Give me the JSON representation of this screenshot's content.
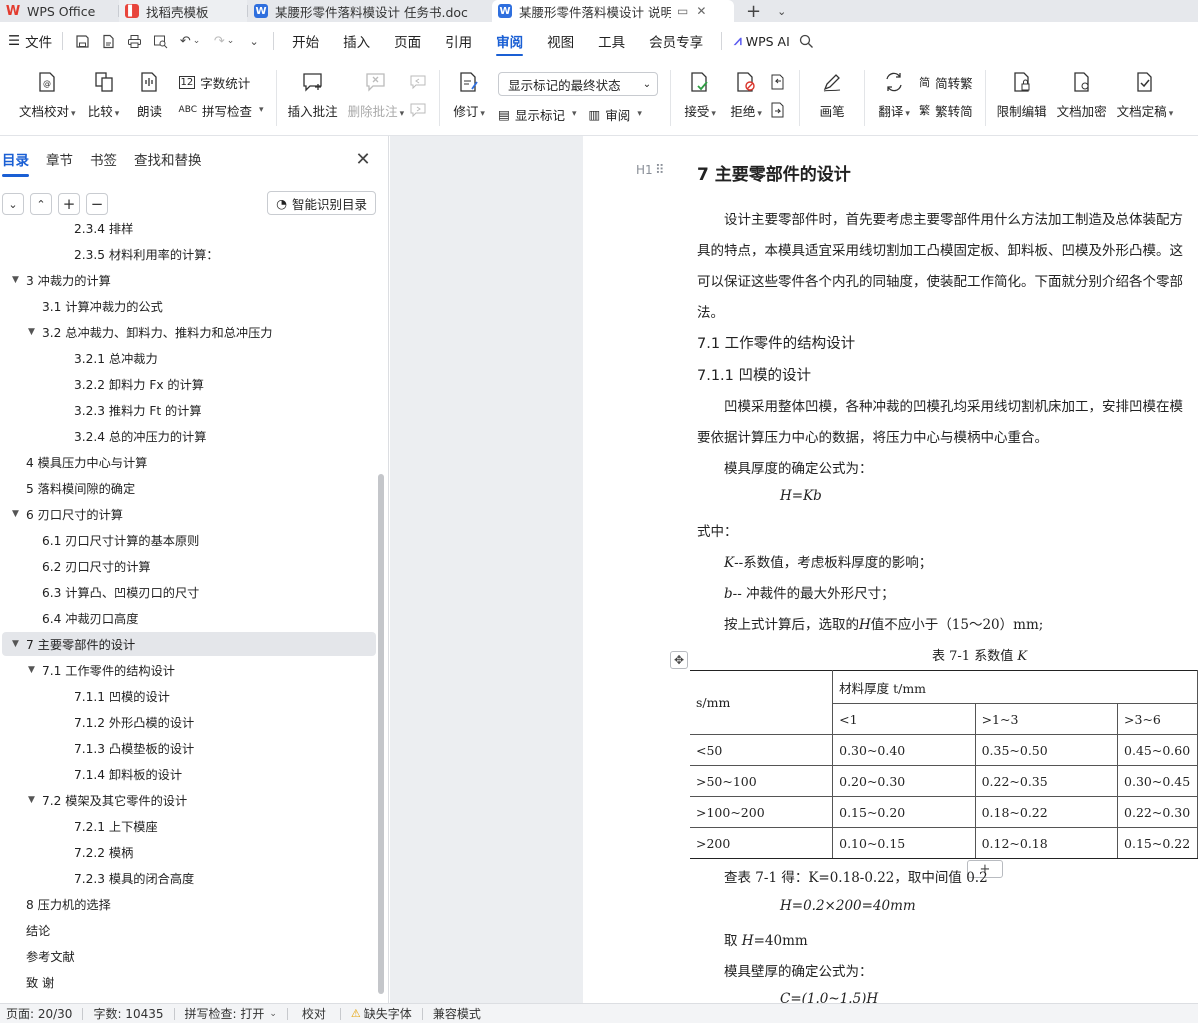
{
  "tabs": [
    {
      "label": "WPS Office",
      "icon": "wps-logo-icon",
      "color": "#e33b2e"
    },
    {
      "label": "找稻壳模板",
      "icon": "docer-icon",
      "color": "#e8453c"
    },
    {
      "label": "某腰形零件落料模设计 任务书.doc",
      "icon": "word-doc-icon",
      "color": "#2f6fde"
    },
    {
      "label": "某腰形零件落料模设计 说明书",
      "icon": "word-doc-icon",
      "color": "#2f6fde"
    }
  ],
  "menubar": {
    "file": "文件",
    "items": [
      "开始",
      "插入",
      "页面",
      "引用",
      "审阅",
      "视图",
      "工具",
      "会员专享"
    ],
    "active": "审阅",
    "ai": "WPS AI"
  },
  "ribbon": {
    "doc_check": "文档校对",
    "compare": "比较",
    "read_aloud": "朗读",
    "word_count": "字数统计",
    "spell_check": "拼写检查",
    "insert_comment": "插入批注",
    "delete_comment": "删除批注",
    "track_changes": "修订",
    "display_select": "显示标记的最终状态",
    "show_markup": "显示标记",
    "review": "审阅",
    "accept": "接受",
    "reject": "拒绝",
    "pen": "画笔",
    "translate": "翻译",
    "to_traditional": "简转繁",
    "to_simplified": "繁转简",
    "restrict_edit": "限制编辑",
    "encrypt": "文档加密",
    "finalize": "文档定稿"
  },
  "nav_panel": {
    "tabs": [
      "目录",
      "章节",
      "书签",
      "查找和替换"
    ],
    "active_tab": "目录",
    "smart_toc": "智能识别目录",
    "toc": [
      {
        "label": "2.3.4  排样",
        "level": 3,
        "arrow": ""
      },
      {
        "label": "2.3.5  材料利用率的计算：",
        "level": 3,
        "arrow": ""
      },
      {
        "label": "3  冲裁力的计算",
        "level": 1,
        "arrow": "▼"
      },
      {
        "label": "3.1  计算冲裁力的公式",
        "level": 2,
        "arrow": ""
      },
      {
        "label": "3.2  总冲裁力、卸料力、推料力和总冲压力",
        "level": 2,
        "arrow": "▼"
      },
      {
        "label": "3.2.1  总冲裁力",
        "level": 3,
        "arrow": ""
      },
      {
        "label": "3.2.2  卸料力 Fx 的计算",
        "level": 3,
        "arrow": ""
      },
      {
        "label": "3.2.3  推料力 Ft 的计算",
        "level": 3,
        "arrow": ""
      },
      {
        "label": "3.2.4  总的冲压力的计算",
        "level": 3,
        "arrow": ""
      },
      {
        "label": "4  模具压力中心与计算",
        "level": 1,
        "arrow": ""
      },
      {
        "label": "5  落料模间隙的确定",
        "level": 1,
        "arrow": ""
      },
      {
        "label": "6  刃口尺寸的计算",
        "level": 1,
        "arrow": "▼"
      },
      {
        "label": "6.1  刃口尺寸计算的基本原则",
        "level": 2,
        "arrow": ""
      },
      {
        "label": "6.2  刃口尺寸的计算",
        "level": 2,
        "arrow": ""
      },
      {
        "label": "6.3  计算凸、凹模刃口的尺寸",
        "level": 2,
        "arrow": ""
      },
      {
        "label": "6.4  冲裁刃口高度",
        "level": 2,
        "arrow": ""
      },
      {
        "label": "7  主要零部件的设计",
        "level": 1,
        "arrow": "▼",
        "selected": true
      },
      {
        "label": "7.1  工作零件的结构设计",
        "level": 2,
        "arrow": "▼"
      },
      {
        "label": "7.1.1  凹模的设计",
        "level": 3,
        "arrow": ""
      },
      {
        "label": "7.1.2  外形凸模的设计",
        "level": 3,
        "arrow": ""
      },
      {
        "label": "7.1.3  凸模垫板的设计",
        "level": 3,
        "arrow": ""
      },
      {
        "label": "7.1.4  卸料板的设计",
        "level": 3,
        "arrow": ""
      },
      {
        "label": "7.2  模架及其它零件的设计",
        "level": 2,
        "arrow": "▼"
      },
      {
        "label": "7.2.1  上下模座",
        "level": 3,
        "arrow": ""
      },
      {
        "label": "7.2.2  模柄",
        "level": 3,
        "arrow": ""
      },
      {
        "label": "7.2.3  模具的闭合高度",
        "level": 3,
        "arrow": ""
      },
      {
        "label": "8  压力机的选择",
        "level": 1,
        "arrow": ""
      },
      {
        "label": "结论",
        "level": 1,
        "arrow": ""
      },
      {
        "label": "参考文献",
        "level": 1,
        "arrow": ""
      },
      {
        "label": "致  谢",
        "level": 1,
        "arrow": ""
      }
    ]
  },
  "document": {
    "heading_marker": "H1",
    "h1": "7  主要零部件的设计",
    "p1_l1": "设计主要零部件时，首先要考虑主要零部件用什么方法加工制造及总体装配方",
    "p1_l2": "具的特点，本模具适宜采用线切割加工凸模固定板、卸料板、凹模及外形凸模。这",
    "p1_l3": "可以保证这些零件各个内孔的同轴度，使装配工作简化。下面就分别介绍各个零部",
    "p1_l4": "法。",
    "h2": "7.1  工作零件的结构设计",
    "h3": "7.1.1  凹模的设计",
    "p2_l1": "凹模采用整体凹模，各种冲裁的凹模孔均采用线切割机床加工，安排凹模在模",
    "p2_l2": "要依据计算压力中心的数据，将压力中心与模柄中心重合。",
    "p3": "模具厚度的确定公式为：",
    "formula1": "H=Kb",
    "p4": "式中：",
    "def_k_var": "K",
    "def_k": "--系数值，考虑板料厚度的影响；",
    "def_b_var": "b",
    "def_b": "--  冲裁件的最大外形尺寸；",
    "p5_pre": "按上式计算后，选取的",
    "p5_var": "H",
    "p5_post": "值不应小于（15～20）mm;",
    "table_caption": "表 7-1    系数值",
    "table_caption_var": "K",
    "table": {
      "row_header": "s/mm",
      "group_header": "材料厚度 t/mm",
      "cols": [
        "<1",
        ">1~3",
        ">3~6"
      ],
      "rows": [
        [
          "<50",
          "0.30~0.40",
          "0.35~0.50",
          "0.45~0.60"
        ],
        [
          ">50~100",
          "0.20~0.30",
          "0.22~0.35",
          "0.30~0.45"
        ],
        [
          ">100~200",
          "0.15~0.20",
          "0.18~0.22",
          "0.22~0.30"
        ],
        [
          ">200",
          "0.10~0.15",
          "0.12~0.18",
          "0.15~0.22"
        ]
      ]
    },
    "p6": "查表 7-1 得：K=0.18-0.22，取中间值 0.2",
    "formula2": "H=0.2×200=40mm",
    "p7_pre": "取",
    "p7_var": "H",
    "p7_post": "=40mm",
    "p8": "模具壁厚的确定公式为：",
    "formula3": "C=(1.0~1.5)H"
  },
  "statusbar": {
    "page": "页面: 20/30",
    "words": "字数: 10435",
    "spell": "拼写检查: 打开",
    "proof": "校对",
    "missing_font": "缺失字体",
    "compat": "兼容模式"
  }
}
